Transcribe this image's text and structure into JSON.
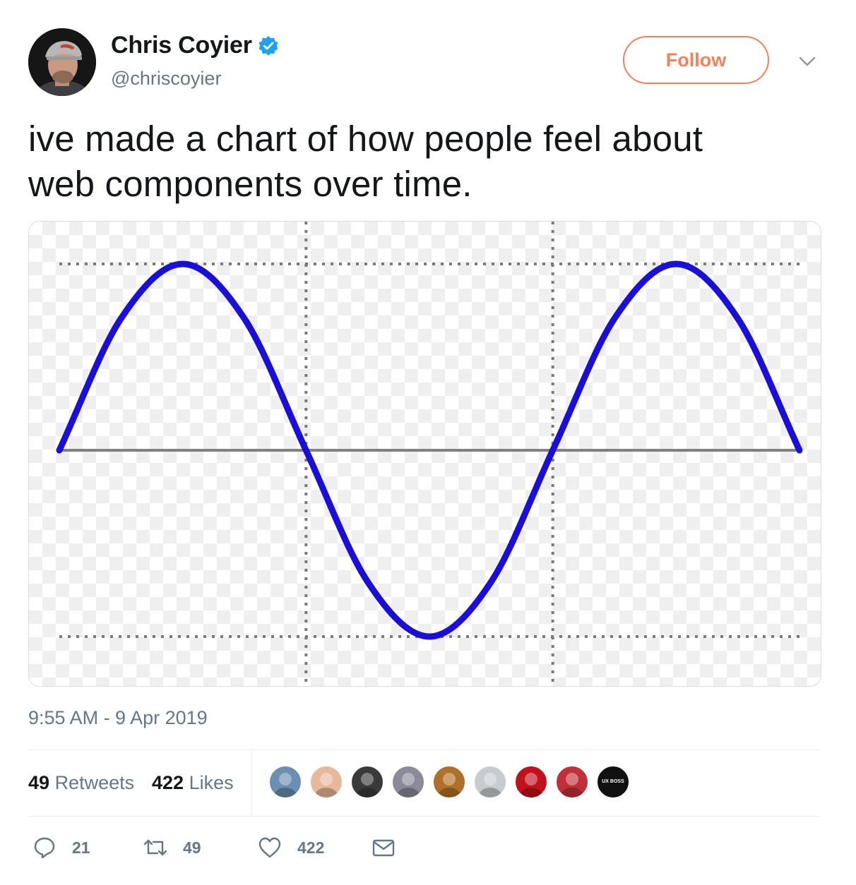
{
  "author": {
    "display_name": "Chris Coyier",
    "handle": "@chriscoyier",
    "verified": true,
    "avatar_icon": "user-avatar"
  },
  "follow_label": "Follow",
  "text_lines": [
    "ive made a chart of how people feel about",
    "web components over time."
  ],
  "timestamp": "9:55 AM - 9 Apr 2019",
  "stats": {
    "retweets_count": "49",
    "retweets_label": "Retweets",
    "likes_count": "422",
    "likes_label": "Likes"
  },
  "likers": [
    {
      "color": "#6a8fb0"
    },
    {
      "color": "#e8b89a"
    },
    {
      "color": "#3a3a3a"
    },
    {
      "color": "#8a8a9a"
    },
    {
      "color": "#b0702a"
    },
    {
      "color": "#c8ccd0"
    },
    {
      "color": "#c0121a"
    },
    {
      "color": "#c0303a"
    },
    {
      "color": "#111111",
      "text": "UX BOSS"
    }
  ],
  "actions": {
    "reply_count": "21",
    "retweet_count": "49",
    "like_count": "422"
  },
  "colors": {
    "follow": "#f4805a",
    "verified": "#1da1f2",
    "muted": "#657786",
    "curve": "#1a0fd6",
    "baseline": "#808080",
    "gridline": "#7a7a7a"
  },
  "chart_data": {
    "type": "line",
    "title": "",
    "xlabel": "",
    "ylabel": "",
    "x": [
      0,
      0.125,
      0.25,
      0.375,
      0.5,
      0.625,
      0.75,
      0.875,
      1,
      1.125,
      1.25,
      1.375,
      1.5
    ],
    "series": [
      {
        "values": [
          0,
          0.707,
          1,
          0.707,
          0,
          -0.707,
          -1,
          -0.707,
          0,
          0.707,
          1,
          0.707,
          0
        ]
      }
    ],
    "xlim": [
      0,
      1.5
    ],
    "ylim": [
      -1,
      1
    ],
    "reference_lines": {
      "horizontal_solid": [
        0
      ],
      "horizontal_dotted": [
        1,
        -1
      ],
      "vertical_dotted": [
        0.5,
        1
      ]
    },
    "grid": false,
    "legend": "none"
  }
}
